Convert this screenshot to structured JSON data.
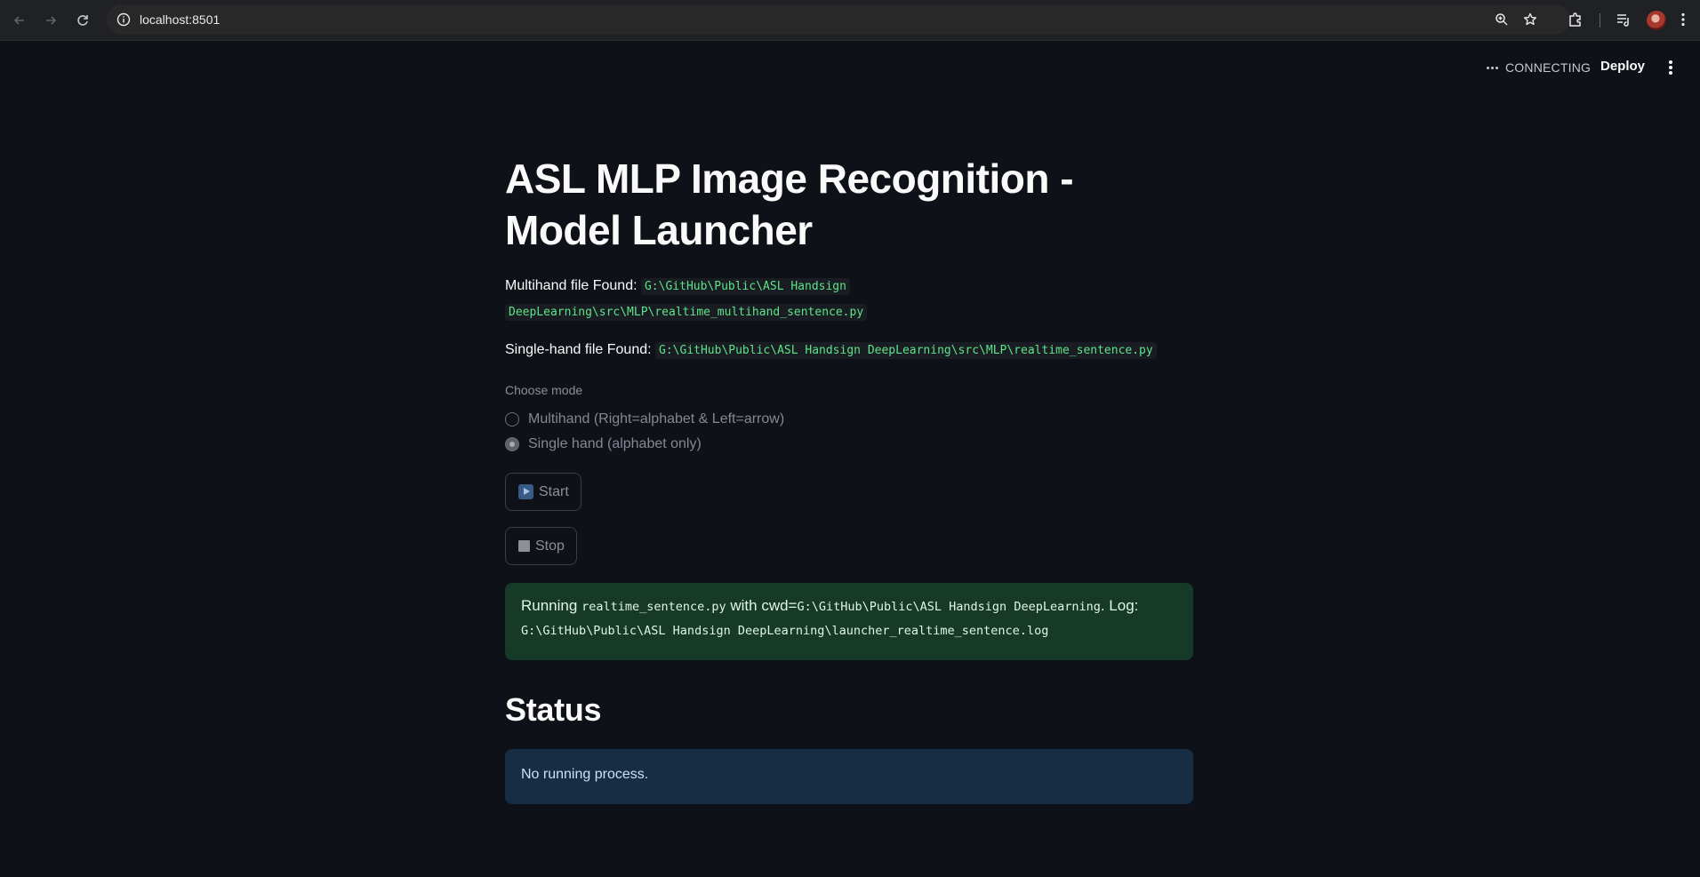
{
  "browser": {
    "url": "localhost:8501"
  },
  "header": {
    "status": "CONNECTING",
    "deploy_label": "Deploy"
  },
  "main": {
    "title": "ASL MLP Image Recognition - Model Launcher",
    "multihand": {
      "label": "Multihand file Found:",
      "path_line1": "G:\\GitHub\\Public\\ASL Handsign",
      "path_line2": "DeepLearning\\src\\MLP\\realtime_multihand_sentence.py"
    },
    "singlehand": {
      "label": "Single-hand file Found:",
      "path": "G:\\GitHub\\Public\\ASL Handsign DeepLearning\\src\\MLP\\realtime_sentence.py"
    },
    "mode": {
      "label": "Choose mode",
      "options": [
        {
          "label": "Multihand (Right=alphabet & Left=arrow)",
          "selected": false
        },
        {
          "label": "Single hand (alphabet only)",
          "selected": true
        }
      ]
    },
    "buttons": {
      "start": "Start",
      "stop": "Stop"
    },
    "running": {
      "prefix": "Running",
      "script": "realtime_sentence.py",
      "with_cwd": "with cwd=",
      "cwd": "G:\\GitHub\\Public\\ASL Handsign DeepLearning",
      "log_label": ". Log:",
      "log_path": "G:\\GitHub\\Public\\ASL Handsign DeepLearning\\launcher_realtime_sentence.log"
    },
    "status_heading": "Status",
    "status_message": "No running process."
  },
  "colors": {
    "background": "#0e1117",
    "success_bg": "#173928",
    "info_bg": "#172d43",
    "code_text": "#5ce488"
  }
}
